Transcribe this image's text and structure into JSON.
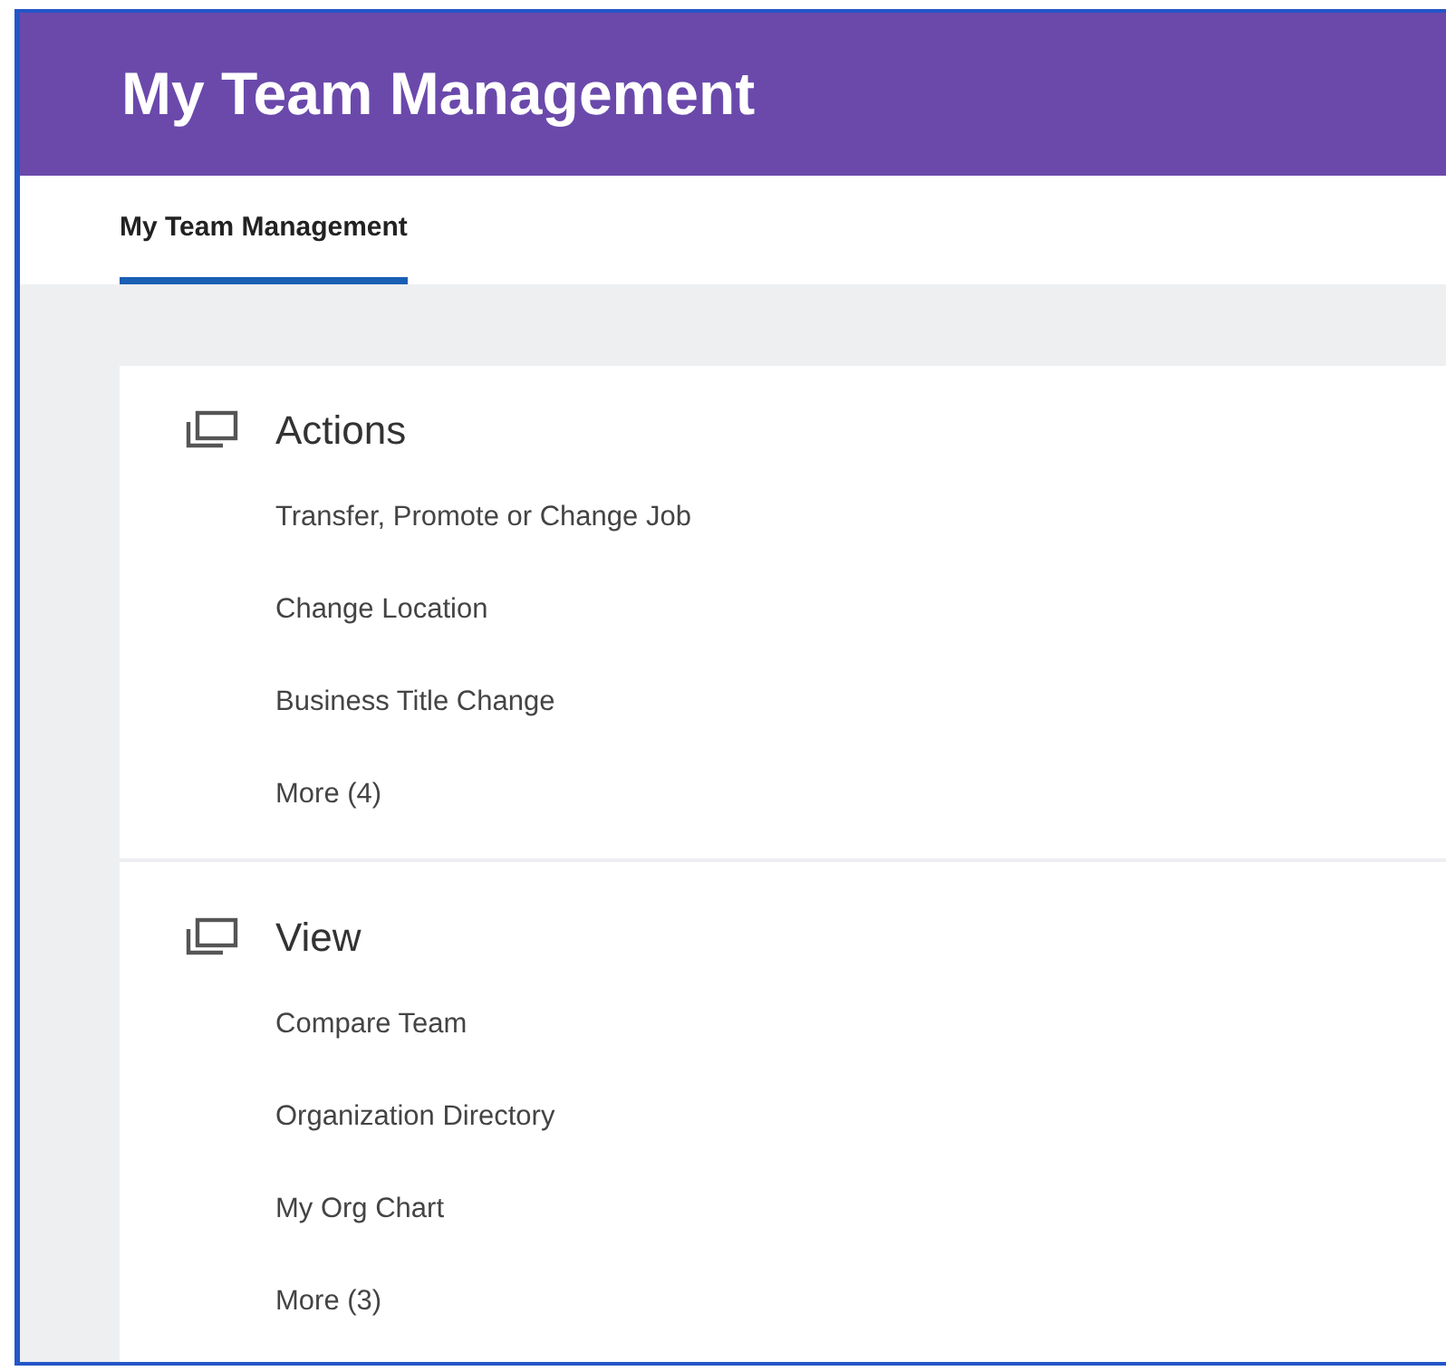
{
  "header": {
    "title": "My Team Management"
  },
  "tabs": [
    {
      "label": "My Team Management",
      "selected": true
    }
  ],
  "sections": [
    {
      "title": "Actions",
      "items": [
        "Transfer, Promote or Change Job",
        "Change Location",
        "Business Title Change",
        "More (4)"
      ]
    },
    {
      "title": "View",
      "items": [
        "Compare Team",
        "Organization Directory",
        "My Org Chart",
        "More (3)"
      ]
    }
  ]
}
